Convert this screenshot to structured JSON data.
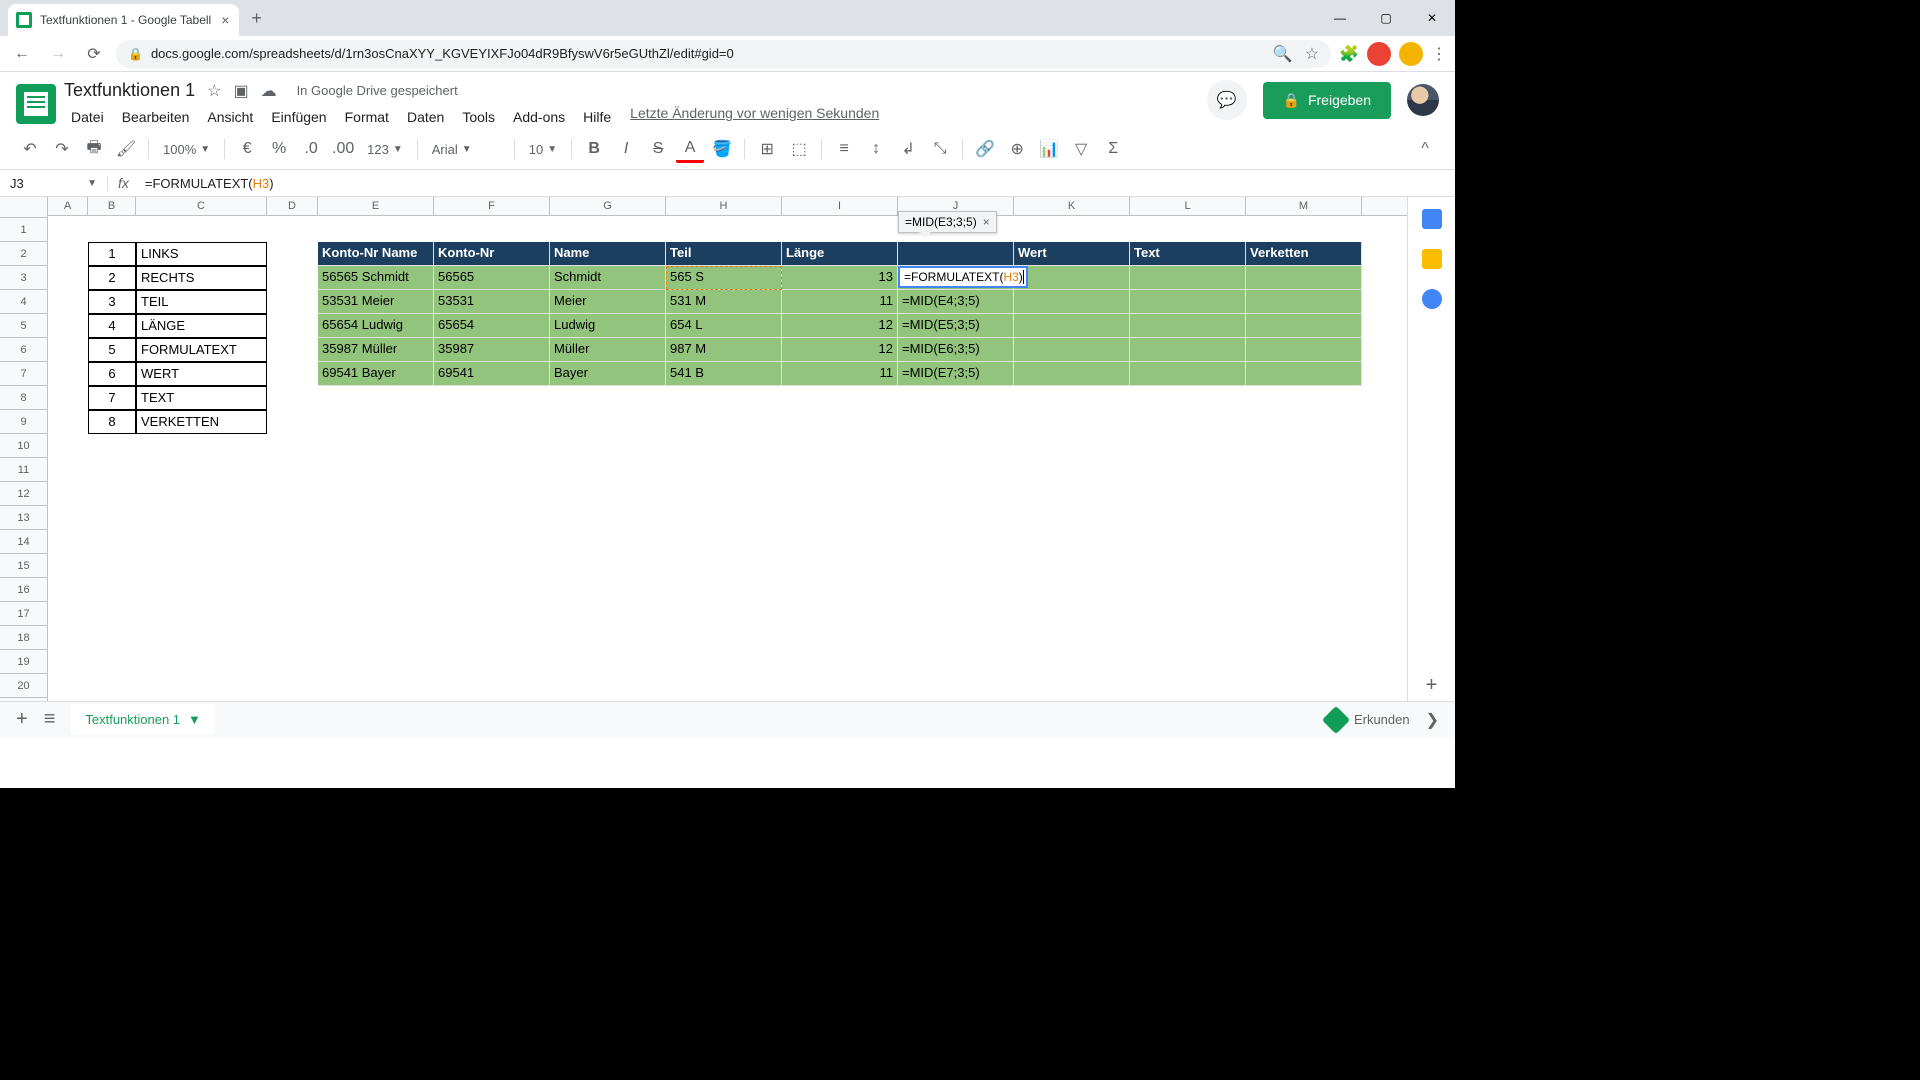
{
  "browser": {
    "tab_title": "Textfunktionen 1 - Google Tabell",
    "url": "docs.google.com/spreadsheets/d/1rn3osCnaXYY_KGVEYIXFJo04dR9BfyswV6r5eGUthZl/edit#gid=0"
  },
  "app": {
    "doc_title": "Textfunktionen 1",
    "save_status": "In Google Drive gespeichert",
    "share_label": "Freigeben",
    "last_edit": "Letzte Änderung vor wenigen Sekunden",
    "menu": [
      "Datei",
      "Bearbeiten",
      "Ansicht",
      "Einfügen",
      "Format",
      "Daten",
      "Tools",
      "Add-ons",
      "Hilfe"
    ]
  },
  "toolbar": {
    "zoom": "100%",
    "font": "Arial",
    "font_size": "10",
    "number_format": "123"
  },
  "formula_bar": {
    "cell_ref": "J3",
    "prefix": "=FORMULATEXT(",
    "ref": "H3",
    "suffix": ")"
  },
  "preview": {
    "value": "=MID(E3;3;5)"
  },
  "editing": {
    "prefix": "=FORMULATEXT(",
    "ref": "H3",
    "suffix": ")"
  },
  "columns": [
    "A",
    "B",
    "C",
    "D",
    "E",
    "F",
    "G",
    "H",
    "I",
    "J",
    "K",
    "L",
    "M"
  ],
  "left_table": {
    "rows": [
      {
        "n": "1",
        "f": "LINKS"
      },
      {
        "n": "2",
        "f": "RECHTS"
      },
      {
        "n": "3",
        "f": "TEIL"
      },
      {
        "n": "4",
        "f": "LÄNGE"
      },
      {
        "n": "5",
        "f": "FORMULATEXT"
      },
      {
        "n": "6",
        "f": "WERT"
      },
      {
        "n": "7",
        "f": "TEXT"
      },
      {
        "n": "8",
        "f": "VERKETTEN"
      }
    ]
  },
  "main_table": {
    "headers": {
      "E": "Konto-Nr Name",
      "F": "Konto-Nr",
      "G": "Name",
      "H": "Teil",
      "I": "Länge",
      "J": "",
      "K": "Wert",
      "L": "Text",
      "M": "Verketten"
    },
    "rows": [
      {
        "E": "56565 Schmidt",
        "F": "56565",
        "G": "Schmidt",
        "H": "565 S",
        "I": "13",
        "J": "=MID(E3;3;5)"
      },
      {
        "E": "53531 Meier",
        "F": "53531",
        "G": "Meier",
        "H": "531 M",
        "I": "11",
        "J": "=MID(E4;3;5)"
      },
      {
        "E": "65654 Ludwig",
        "F": "65654",
        "G": "Ludwig",
        "H": "654 L",
        "I": "12",
        "J": "=MID(E5;3;5)"
      },
      {
        "E": "35987 Müller",
        "F": "35987",
        "G": "Müller",
        "H": "987 M",
        "I": "12",
        "J": "=MID(E6;3;5)"
      },
      {
        "E": "69541 Bayer",
        "F": "69541",
        "G": "Bayer",
        "H": "541 B",
        "I": "11",
        "J": "=MID(E7;3;5)"
      }
    ]
  },
  "sheet_tab": "Textfunktionen 1",
  "explore": "Erkunden"
}
